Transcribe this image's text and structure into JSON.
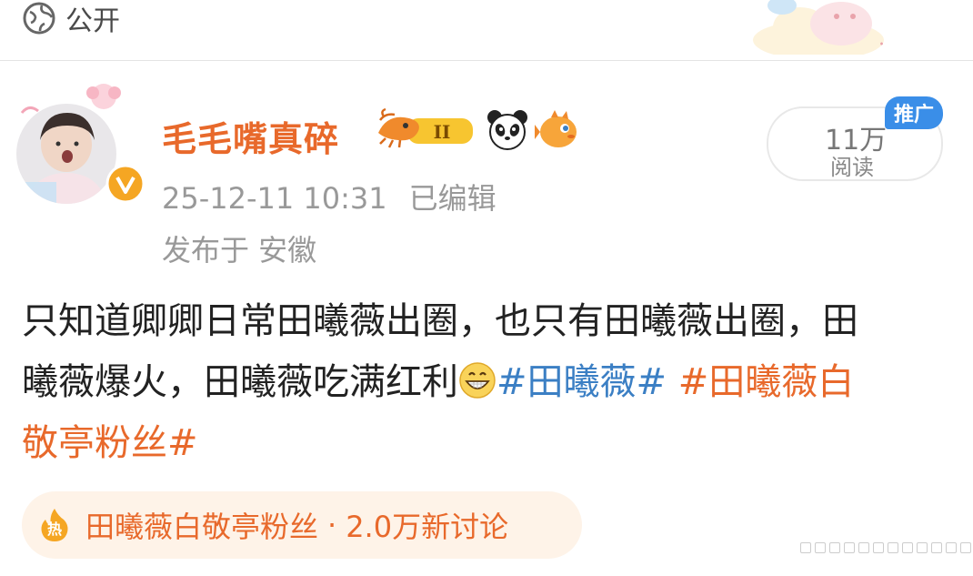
{
  "top": {
    "privacy_label": "公开"
  },
  "author": {
    "name": "毛毛嘴真碎",
    "avatar_caption": "",
    "badges": [
      "shrimp-level-badge",
      "panda-icon",
      "pufferfish-icon"
    ],
    "badge_level_text": "II"
  },
  "post_meta": {
    "time": "25-12-11 10:31",
    "edited": "已编辑",
    "location": "发布于 安徽"
  },
  "stats": {
    "read_count": "11万",
    "read_label": "阅读",
    "promo_tag": "推广"
  },
  "post": {
    "line1": "只知道卿卿日常田曦薇出圈，也只有田曦薇出圈，田",
    "line2_text": "曦薇爆火，田曦薇吃满红利",
    "line2_tag_blue": "#田曦薇#",
    "line2_tag_orange": " #田曦薇白",
    "line3_tag_orange": "敬亭粉丝#"
  },
  "topic": {
    "icon_text": "热",
    "title": "田曦薇白敬亭粉丝",
    "separator": "·",
    "count": "2.0万新讨论"
  },
  "colors": {
    "accent_orange": "#e8692b",
    "tag_blue": "#3b7fc4",
    "promo_blue": "#3a8ee8",
    "chip_bg": "#fef3e8"
  }
}
